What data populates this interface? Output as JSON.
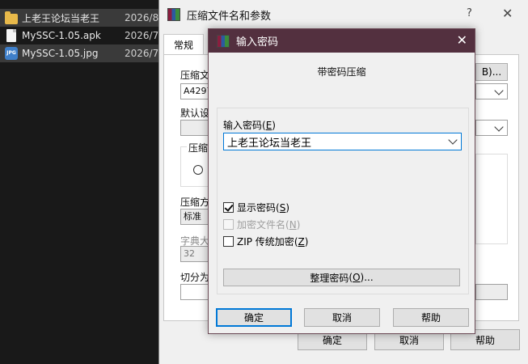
{
  "explorer": {
    "files": [
      {
        "name": "上老王论坛当老王",
        "date": "2026/8,",
        "type": "folder"
      },
      {
        "name": "MySSC-1.05.apk",
        "date": "2026/7,",
        "type": "file"
      },
      {
        "name": "MySSC-1.05.jpg",
        "date": "2026/7,",
        "type": "jpg"
      }
    ]
  },
  "back_dialog": {
    "title": "压缩文件名和参数",
    "help": "?",
    "close": "✕",
    "tab_general": "常规",
    "label_archive_name": "压缩文",
    "archive_name_value": "A4297",
    "browse_suffix": "B)...",
    "label_default": "默认设",
    "group_format": "压缩",
    "label_method": "压缩方",
    "method_value": "标准",
    "label_dict": "字典大",
    "dict_value": "32",
    "label_split": "切分为",
    "ok": "确定",
    "cancel": "取消",
    "help_btn": "帮助"
  },
  "front_dialog": {
    "title": "输入密码",
    "close": "✕",
    "heading": "带密码压缩",
    "password_label": "输入密码",
    "password_label_key": "E",
    "password_value": "上老王论坛当老王",
    "show_password": "显示密码",
    "show_password_key": "S",
    "encrypt_names": "加密文件名",
    "encrypt_names_key": "N",
    "zip_legacy": "ZIP 传统加密",
    "zip_legacy_key": "Z",
    "organize": "整理密码",
    "organize_key": "O",
    "ok": "确定",
    "cancel": "取消",
    "help": "帮助"
  }
}
